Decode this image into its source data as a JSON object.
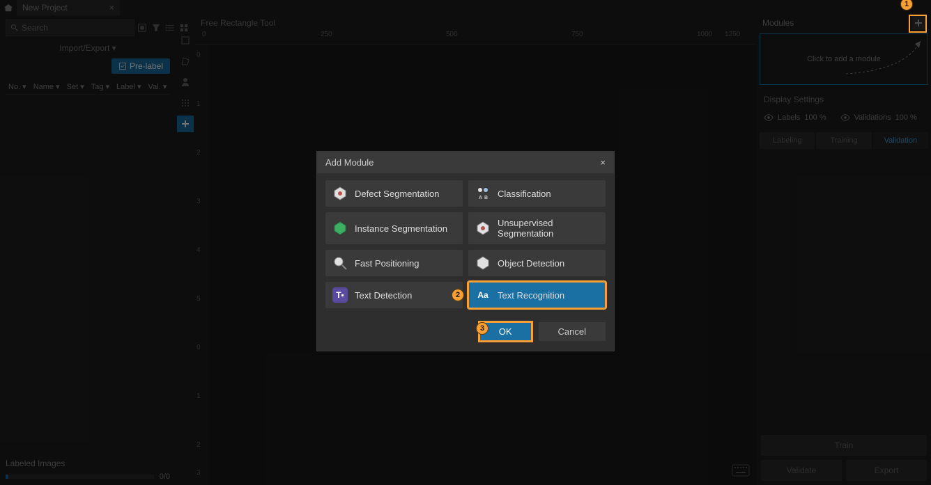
{
  "tab_title": "New Project",
  "search_placeholder": "Search",
  "import_export": "Import/Export ▾",
  "prelabel": "Pre-label",
  "columns": {
    "no": "No. ▾",
    "name": "Name ▾",
    "set": "Set ▾",
    "tag": "Tag ▾",
    "label": "Label ▾",
    "val": "Val. ▾"
  },
  "labeled_title": "Labeled Images",
  "progress_text": "0/0",
  "canvas_tool": "Free Rectangle Tool",
  "ruler_h": [
    "0",
    "250",
    "500",
    "750",
    "1000",
    "1250"
  ],
  "ruler_v": [
    "0",
    "1",
    "2",
    "3",
    "4",
    "5",
    "0",
    "1",
    "2",
    "3"
  ],
  "right": {
    "modules_title": "Modules",
    "add_text": "Click to add a module",
    "display_title": "Display Settings",
    "labels": "Labels",
    "labels_pct": "100 %",
    "vals": "Validations",
    "vals_pct": "100 %",
    "tabs": {
      "labeling": "Labeling",
      "training": "Training",
      "validation": "Validation"
    },
    "train": "Train",
    "validate": "Validate",
    "export": "Export"
  },
  "modal": {
    "title": "Add Module",
    "items": [
      {
        "key": "defect",
        "label": "Defect Segmentation"
      },
      {
        "key": "class",
        "label": "Classification"
      },
      {
        "key": "instance",
        "label": "Instance Segmentation"
      },
      {
        "key": "unsup",
        "label": "Unsupervised Segmentation"
      },
      {
        "key": "fast",
        "label": "Fast Positioning"
      },
      {
        "key": "objdet",
        "label": "Object Detection"
      },
      {
        "key": "txtdet",
        "label": "Text Detection"
      },
      {
        "key": "txtrec",
        "label": "Text Recognition"
      }
    ],
    "ok": "OK",
    "cancel": "Cancel"
  },
  "callouts": {
    "one": "1",
    "two": "2",
    "three": "3"
  }
}
